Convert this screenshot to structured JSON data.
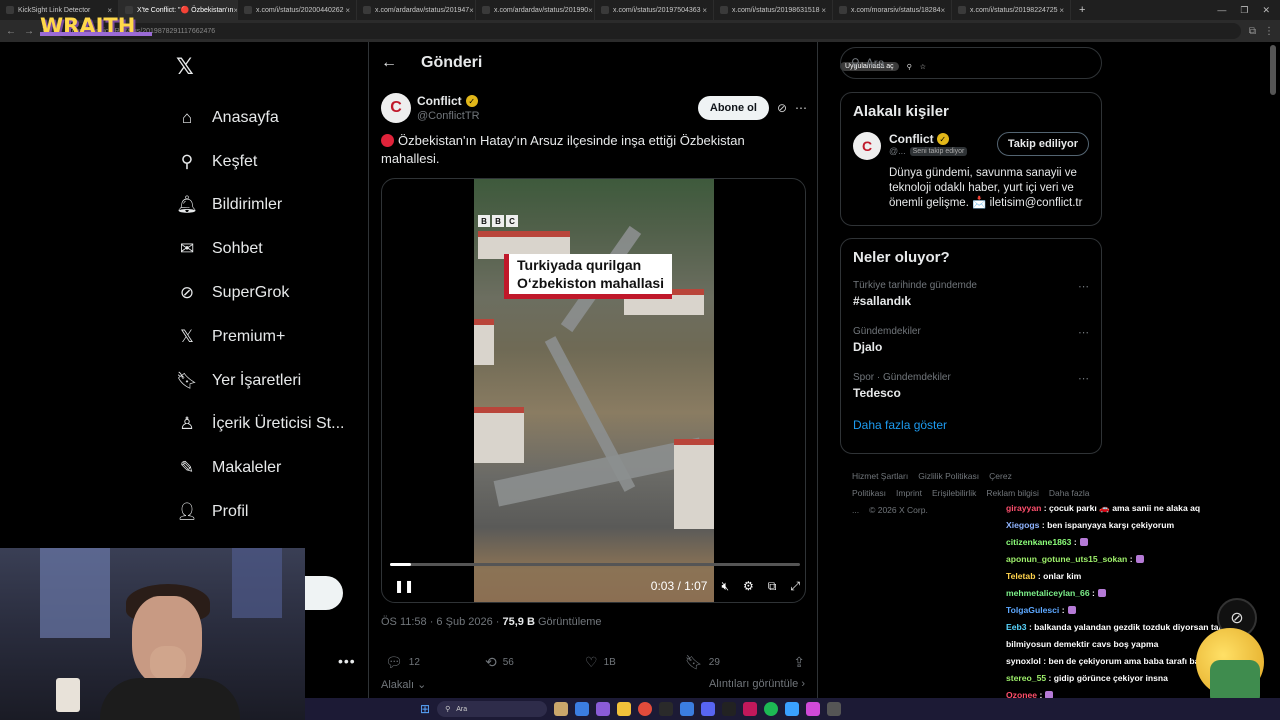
{
  "browser": {
    "tabs": [
      {
        "title": "KickSight Link Detector",
        "active": false
      },
      {
        "title": "X'te Conflict: \"🔴 Özbekistan'ın",
        "active": true
      },
      {
        "title": "x.com/i/status/20200440262",
        "active": false
      },
      {
        "title": "x.com/ardardav/status/201947",
        "active": false
      },
      {
        "title": "x.com/ardardav/status/201990",
        "active": false
      },
      {
        "title": "x.com/i/status/20197504363",
        "active": false
      },
      {
        "title": "x.com/i/status/20198631518",
        "active": false
      },
      {
        "title": "x.com/morarsiv/status/18284",
        "active": false
      },
      {
        "title": "x.com/i/status/20198224725",
        "active": false
      }
    ],
    "url": "x.com/ConflictTR/status/2019878291117662476",
    "app_badge": "Uygulamada aç",
    "brand_overlay": "WRAITH"
  },
  "nav": {
    "logo": "𝕏",
    "items": [
      {
        "label": "Anasayfa",
        "icon": "home-icon",
        "glyph": "⌂"
      },
      {
        "label": "Keşfet",
        "icon": "search-icon",
        "glyph": "⚲"
      },
      {
        "label": "Bildirimler",
        "icon": "bell-icon",
        "glyph": "🔔︎"
      },
      {
        "label": "Sohbet",
        "icon": "mail-icon",
        "glyph": "✉"
      },
      {
        "label": "SuperGrok",
        "icon": "grok-icon",
        "glyph": "⊘"
      },
      {
        "label": "Premium+",
        "icon": "x-logo-icon",
        "glyph": "𝕏"
      },
      {
        "label": "Yer İşaretleri",
        "icon": "bookmark-icon",
        "glyph": "🔖︎"
      },
      {
        "label": "İçerik Üreticisi St...",
        "icon": "creator-icon",
        "glyph": "♙"
      },
      {
        "label": "Makaleler",
        "icon": "article-icon",
        "glyph": "✎"
      },
      {
        "label": "Profil",
        "icon": "profile-icon",
        "glyph": "👤︎"
      },
      {
        "label": "Daha fazla",
        "icon": "more-icon",
        "glyph": "⋯"
      }
    ]
  },
  "post": {
    "header_title": "Gönderi",
    "author_name": "Conflict",
    "author_handle": "@ConflictTR",
    "avatar_letter": "C",
    "subscribe_label": "Abone ol",
    "text": "Özbekistan'ın Hatay'ın Arsuz ilçesinde inşa ettiği Özbekistan mahallesi.",
    "video": {
      "watermark": [
        "B",
        "B",
        "C"
      ],
      "overlay_line1": "Turkiyada qurilgan",
      "overlay_line2": "O‘zbekiston mahallasi",
      "time": "0:03 / 1:07",
      "progress": 0.05
    },
    "meta_time": "ÖS 11:58 · 6 Şub 2026 · ",
    "views_count": "75,9 B",
    "views_label": " Görüntüleme",
    "stats": {
      "replies": "12",
      "reposts": "56",
      "likes": "1B",
      "bookmarks": "29"
    },
    "related_label": "Alakalı",
    "quotes_label": "Alıntıları görüntüle"
  },
  "sidebar": {
    "search_placeholder": "Ara",
    "related_title": "Alakalı kişiler",
    "related": {
      "name": "Conflict",
      "handle": "@...",
      "follows_you": "Seni takip ediyor",
      "button": "Takip ediliyor",
      "bio": "Dünya gündemi, savunma sanayii ve teknoloji odaklı haber, yurt içi veri ve önemli gelişme. 📩 iletisim@conflict.tr"
    },
    "trends_title": "Neler oluyor?",
    "trends": [
      {
        "context": "Türkiye tarihinde gündemde",
        "topic": "#sallandık"
      },
      {
        "context": "Gündemdekiler",
        "topic": "Djalo"
      },
      {
        "context": "Spor · Gündemdekiler",
        "topic": "Tedesco"
      }
    ],
    "show_more": "Daha fazla göster",
    "footer": [
      "Hizmet Şartları",
      "Gizlilik Politikası",
      "Çerez Politikası",
      "Imprint",
      "Erişilebilirlik",
      "Reklam bilgisi",
      "Daha fazla ...",
      "© 2026 X Corp."
    ]
  },
  "chat": [
    {
      "user": "girayyan",
      "color": "#ff4f6d",
      "msg": ": çocuk parkı 🚗 ama sanii ne alaka aq"
    },
    {
      "user": "Xiegogs",
      "color": "#8fb4ff",
      "msg": ": ben ispanyaya karşı çekiyorum"
    },
    {
      "user": "citizenkane1863",
      "color": "#8cff7a",
      "msg": ":"
    },
    {
      "user": "aponun_gotune_uts15_sokan",
      "color": "#9ef06b",
      "msg": ":"
    },
    {
      "user": "Teletab",
      "color": "#ffd34d",
      "msg": ": onlar kim"
    },
    {
      "user": "mehmetaliceylan_66",
      "color": "#7cf08a",
      "msg": ":"
    },
    {
      "user": "TolgaGulesci",
      "color": "#5da8ff",
      "msg": ":"
    },
    {
      "user": "Eeb3",
      "color": "#5ad6ff",
      "msg": ": balkanda yalandan gezdik tozduk diyorsan tarih"
    },
    {
      "user": "",
      "color": "#ffffff",
      "msg": "bilmiyosun demektir cavs boş yapma"
    },
    {
      "user": "synoxlol",
      "color": "#ffffff",
      "msg": ": ben de çekiyorum ama baba tarafı balkanlı o yüzden"
    },
    {
      "user": "stereo_55",
      "color": "#9ef06b",
      "msg": ": gidip görünce çekiyor insna"
    },
    {
      "user": "Ozonee",
      "color": "#ff4f6d",
      "msg": ":"
    },
    {
      "user": "TolgaGulesci",
      "color": "#5da8ff",
      "msg": ":"
    }
  ],
  "taskbar": {
    "search_label": "Ara"
  }
}
